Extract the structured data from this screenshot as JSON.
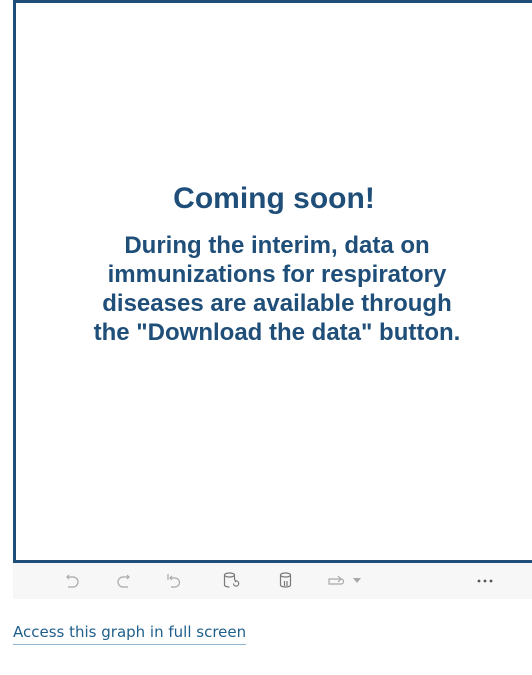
{
  "viz": {
    "title": "Coming soon!",
    "body": "During the interim, data on\nimmunizations for respiratory\ndiseases are available through\nthe \"Download the data\" button."
  },
  "toolbar": {
    "buttons": [
      {
        "icon": "undo-icon"
      },
      {
        "icon": "redo-icon"
      },
      {
        "icon": "revert-icon"
      },
      {
        "icon": "refresh-data-icon"
      },
      {
        "icon": "pause-updates-icon"
      },
      {
        "icon": "share-icon"
      },
      {
        "icon": "more-options-icon"
      }
    ]
  },
  "link": {
    "label": "Access this graph in full screen"
  },
  "colors": {
    "accent": "#1f4e79",
    "toolbar_bg": "#f7f7f7",
    "icon_gray": "#a9a9a9",
    "link": "#1f5f8b"
  }
}
